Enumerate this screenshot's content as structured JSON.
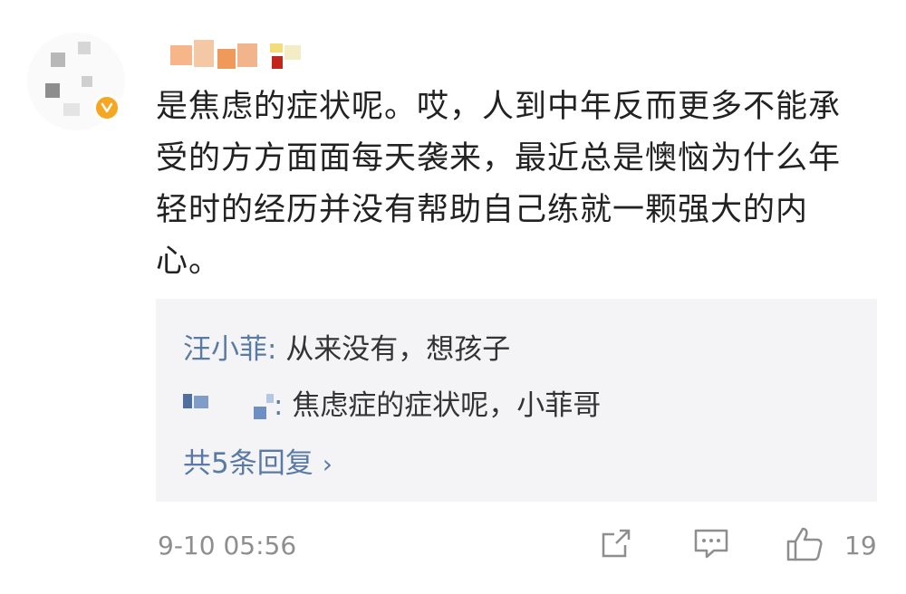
{
  "comment": {
    "avatar_icon": "avatar-pixelated",
    "verified_icon": "verified-badge-icon",
    "verified_color": "#f5a623",
    "body_text": "是焦虑的症状呢。哎，人到中年反而更多不能承受的方方面面每天袭来，最近总是懊恼为什么年轻时的经历并没有帮助自己练就一颗强大的内心。",
    "replies": [
      {
        "author": "汪小菲",
        "separator": ": ",
        "text": "从来没有，想孩子"
      },
      {
        "author": "",
        "separator": ": ",
        "text": "焦虑症的症状呢，小菲哥"
      }
    ],
    "more_replies_label": "共5条回复",
    "more_replies_chevron": "›",
    "timestamp": "9-10 05:56",
    "like_count": "19",
    "link_color": "#5a7aa6"
  }
}
